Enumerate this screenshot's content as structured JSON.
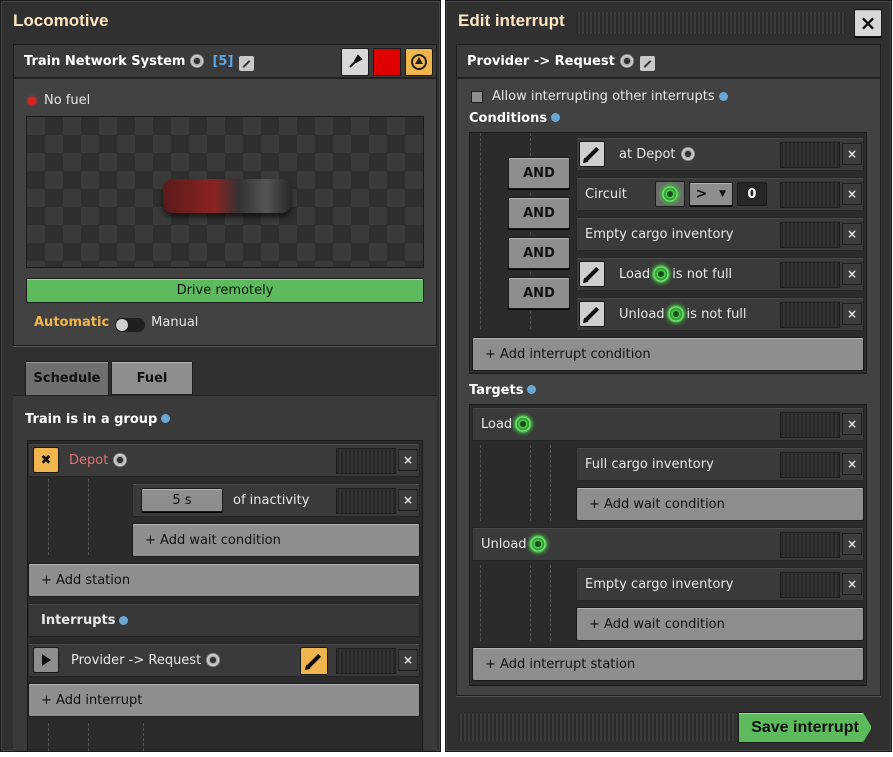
{
  "locomotive": {
    "window_title": "Locomotive",
    "train_name": "Train Network System",
    "train_count": "[5]",
    "fuel_status": "No fuel",
    "drive_remotely": "Drive remotely",
    "mode_automatic": "Automatic",
    "mode_manual": "Manual",
    "color_swatch": "#e00000",
    "tabs": [
      {
        "label": "Schedule",
        "active": true
      },
      {
        "label": "Fuel",
        "active": false
      }
    ],
    "group_label": "Train is in a group",
    "station": {
      "name": "Depot",
      "condition_value": "5 s",
      "condition_text": "of inactivity",
      "add_wait_condition": "+ Add wait condition"
    },
    "add_station": "+ Add station",
    "interrupts_label": "Interrupts",
    "interrupt_name": "Provider -> Request",
    "add_interrupt": "+ Add interrupt"
  },
  "edit_interrupt": {
    "window_title": "Edit interrupt",
    "close_glyph": "×",
    "name": "Provider -> Request",
    "allow_interrupting": "Allow interrupting other interrupts",
    "conditions_label": "Conditions",
    "conditions": [
      {
        "connector": "",
        "prefix": "at Depot",
        "suffix": ""
      },
      {
        "connector": "AND",
        "prefix": "Circuit",
        "suffix": ""
      },
      {
        "connector": "AND",
        "prefix": "Empty cargo inventory",
        "suffix": ""
      },
      {
        "connector": "AND",
        "prefix": "Load",
        "suffix": "is not full"
      },
      {
        "connector": "AND",
        "prefix": "Unload",
        "suffix": "is not full"
      }
    ],
    "circuit_operator": ">",
    "circuit_value": "0",
    "add_interrupt_condition": "+ Add interrupt condition",
    "targets_label": "Targets",
    "targets": [
      {
        "station": "Load",
        "condition": "Full cargo inventory",
        "add": "+ Add wait condition"
      },
      {
        "station": "Unload",
        "condition": "Empty cargo inventory",
        "add": "+ Add wait condition"
      }
    ],
    "add_interrupt_station": "+ Add interrupt station",
    "save_button": "Save interrupt"
  }
}
